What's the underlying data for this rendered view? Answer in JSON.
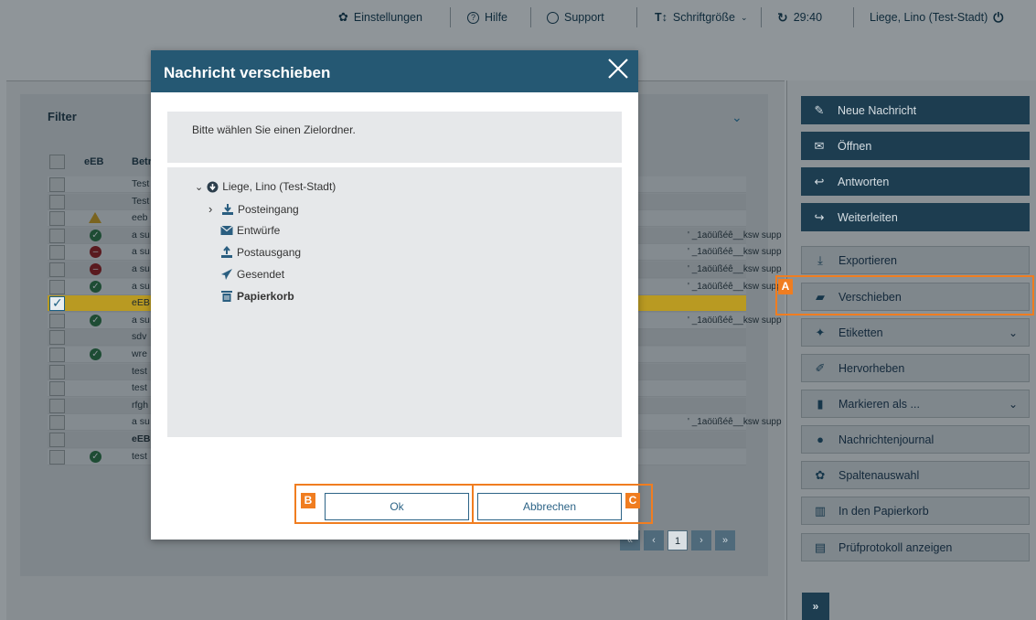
{
  "topbar": {
    "settings": "Einstellungen",
    "help": "Hilfe",
    "support": "Support",
    "font_size": "Schriftgröße",
    "timer": "29:40",
    "user": "Liege, Lino (Test-Stadt)"
  },
  "filter": {
    "title": "Filter",
    "col_eeb": "eEB",
    "col_subject": "Betr"
  },
  "rows": [
    {
      "status": "",
      "subject": "Test",
      "recipient": "",
      "bold": false,
      "selected": false,
      "checked": false
    },
    {
      "status": "",
      "subject": "Test",
      "recipient": "",
      "bold": false,
      "selected": false,
      "checked": false
    },
    {
      "status": "warn",
      "subject": "eeb",
      "recipient": "",
      "bold": false,
      "selected": false,
      "checked": false
    },
    {
      "status": "ok",
      "subject": "a su",
      "recipient": "' _1aöüßéê__ksw supp",
      "bold": false,
      "selected": false,
      "checked": false
    },
    {
      "status": "no",
      "subject": "a su",
      "recipient": "' _1aöüßéê__ksw supp",
      "bold": false,
      "selected": false,
      "checked": false
    },
    {
      "status": "no",
      "subject": "a su",
      "recipient": "' _1aöüßéê__ksw supp",
      "bold": false,
      "selected": false,
      "checked": false
    },
    {
      "status": "ok",
      "subject": "a su",
      "recipient": "' _1aöüßéê__ksw supp",
      "bold": false,
      "selected": false,
      "checked": false
    },
    {
      "status": "",
      "subject": "eEB",
      "recipient": "",
      "bold": false,
      "selected": true,
      "checked": true
    },
    {
      "status": "ok",
      "subject": "a su",
      "recipient": "' _1aöüßéê__ksw supp",
      "bold": false,
      "selected": false,
      "checked": false
    },
    {
      "status": "",
      "subject": "sdv",
      "recipient": "",
      "bold": false,
      "selected": false,
      "checked": false
    },
    {
      "status": "ok",
      "subject": "wre",
      "recipient": "",
      "bold": false,
      "selected": false,
      "checked": false
    },
    {
      "status": "",
      "subject": "test",
      "recipient": "",
      "bold": false,
      "selected": false,
      "checked": false
    },
    {
      "status": "",
      "subject": "test",
      "recipient": "",
      "bold": false,
      "selected": false,
      "checked": false
    },
    {
      "status": "",
      "subject": "rfgh",
      "recipient": "",
      "bold": false,
      "selected": false,
      "checked": false
    },
    {
      "status": "",
      "subject": "a su",
      "recipient": "' _1aöüßéê__ksw supp",
      "bold": false,
      "selected": false,
      "checked": false
    },
    {
      "status": "",
      "subject": "eEB",
      "recipient": "",
      "bold": true,
      "selected": false,
      "checked": false
    },
    {
      "status": "ok",
      "subject": "test",
      "recipient": "",
      "bold": false,
      "selected": false,
      "checked": false
    }
  ],
  "pager": {
    "first": "«",
    "prev": "‹",
    "current": "1",
    "next": "›",
    "last": "»"
  },
  "sidebar": {
    "new_message": "Neue Nachricht",
    "open": "Öffnen",
    "reply": "Antworten",
    "forward": "Weiterleiten",
    "export": "Exportieren",
    "move": "Verschieben",
    "labels": "Etiketten",
    "highlight": "Hervorheben",
    "mark_as": "Markieren als ...",
    "journal": "Nachrichtenjournal",
    "columns": "Spaltenauswahl",
    "trash": "In den Papierkorb",
    "protocol": "Prüfprotokoll anzeigen",
    "expand": "»"
  },
  "modal": {
    "title": "Nachricht verschieben",
    "instruction": "Bitte wählen Sie einen Zielordner.",
    "tree": {
      "root": "Liege, Lino (Test-Stadt)",
      "inbox": "Posteingang",
      "drafts": "Entwürfe",
      "outbox": "Postausgang",
      "sent": "Gesendet",
      "trash": "Papierkorb"
    },
    "ok": "Ok",
    "cancel": "Abbrechen"
  },
  "callouts": {
    "a": "A",
    "b": "B",
    "c": "C"
  },
  "colors": {
    "primary": "#255873",
    "dark_button": "#1d3d50",
    "callout": "#f07d20",
    "selected_row": "#b99a22"
  }
}
